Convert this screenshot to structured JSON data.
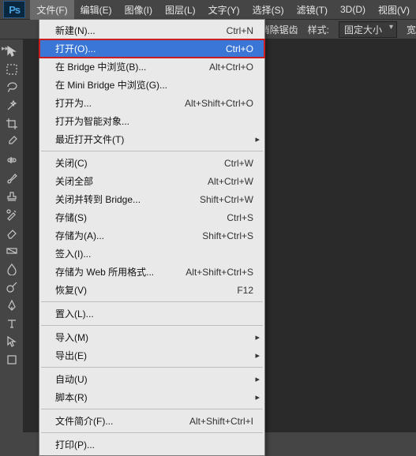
{
  "app": {
    "ps_label": "Ps"
  },
  "menubar": [
    {
      "label": "文件(F)",
      "active": true
    },
    {
      "label": "编辑(E)"
    },
    {
      "label": "图像(I)"
    },
    {
      "label": "图层(L)"
    },
    {
      "label": "文字(Y)"
    },
    {
      "label": "选择(S)"
    },
    {
      "label": "滤镜(T)"
    },
    {
      "label": "3D(D)"
    },
    {
      "label": "视图(V)"
    }
  ],
  "optionsbar": {
    "anti_alias": "消除锯齿",
    "style_label": "样式:",
    "style_value": "固定大小",
    "width_label": "宽"
  },
  "dropdown": [
    {
      "type": "item",
      "label": "新建(N)...",
      "shortcut": "Ctrl+N"
    },
    {
      "type": "item",
      "label": "打开(O)...",
      "shortcut": "Ctrl+O",
      "hover": true,
      "boxed": true
    },
    {
      "type": "item",
      "label": "在 Bridge 中浏览(B)...",
      "shortcut": "Alt+Ctrl+O"
    },
    {
      "type": "item",
      "label": "在 Mini Bridge 中浏览(G)..."
    },
    {
      "type": "item",
      "label": "打开为...",
      "shortcut": "Alt+Shift+Ctrl+O"
    },
    {
      "type": "item",
      "label": "打开为智能对象..."
    },
    {
      "type": "item",
      "label": "最近打开文件(T)",
      "submenu": true
    },
    {
      "type": "sep"
    },
    {
      "type": "item",
      "label": "关闭(C)",
      "shortcut": "Ctrl+W"
    },
    {
      "type": "item",
      "label": "关闭全部",
      "shortcut": "Alt+Ctrl+W"
    },
    {
      "type": "item",
      "label": "关闭并转到 Bridge...",
      "shortcut": "Shift+Ctrl+W"
    },
    {
      "type": "item",
      "label": "存储(S)",
      "shortcut": "Ctrl+S"
    },
    {
      "type": "item",
      "label": "存储为(A)...",
      "shortcut": "Shift+Ctrl+S"
    },
    {
      "type": "item",
      "label": "签入(I)..."
    },
    {
      "type": "item",
      "label": "存储为 Web 所用格式...",
      "shortcut": "Alt+Shift+Ctrl+S"
    },
    {
      "type": "item",
      "label": "恢复(V)",
      "shortcut": "F12"
    },
    {
      "type": "sep"
    },
    {
      "type": "item",
      "label": "置入(L)..."
    },
    {
      "type": "sep"
    },
    {
      "type": "item",
      "label": "导入(M)",
      "submenu": true
    },
    {
      "type": "item",
      "label": "导出(E)",
      "submenu": true
    },
    {
      "type": "sep"
    },
    {
      "type": "item",
      "label": "自动(U)",
      "submenu": true
    },
    {
      "type": "item",
      "label": "脚本(R)",
      "submenu": true
    },
    {
      "type": "sep"
    },
    {
      "type": "item",
      "label": "文件简介(F)...",
      "shortcut": "Alt+Shift+Ctrl+I"
    },
    {
      "type": "sep"
    },
    {
      "type": "item",
      "label": "打印(P)..."
    }
  ],
  "tools": [
    "move",
    "marquee",
    "lasso",
    "wand",
    "crop",
    "eyedropper",
    "healing",
    "brush",
    "stamp",
    "history",
    "eraser",
    "gradient",
    "blur",
    "dodge",
    "pen",
    "type",
    "path",
    "rectangle"
  ]
}
